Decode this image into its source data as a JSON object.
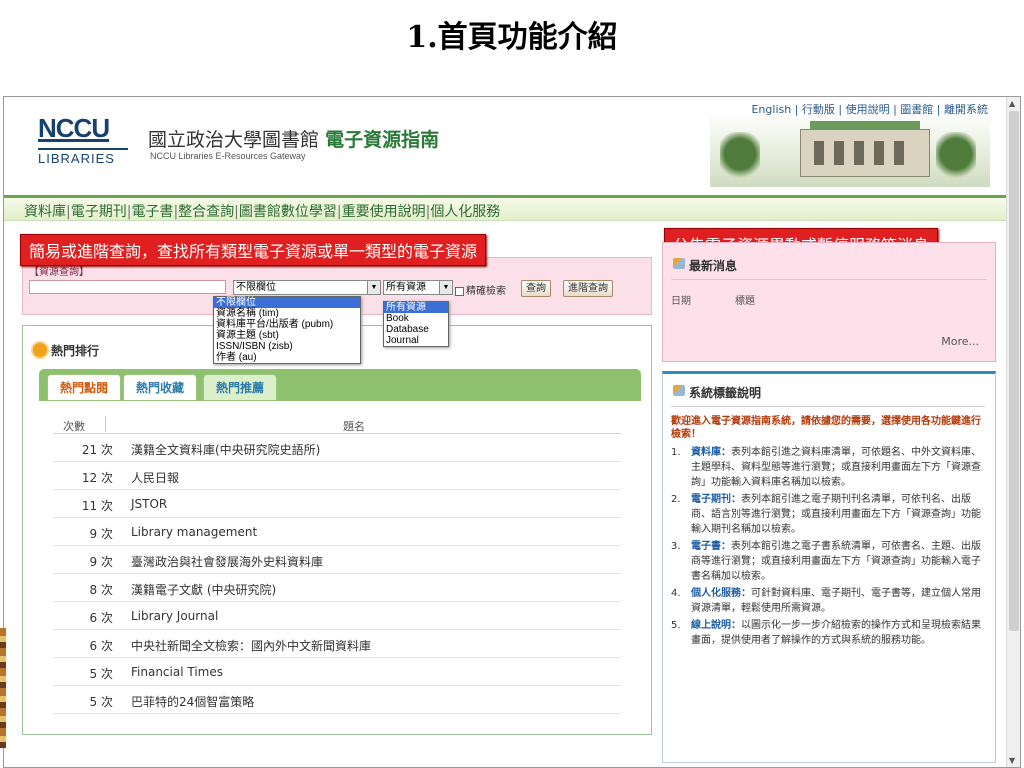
{
  "slide_title": "1.首頁功能介紹",
  "header": {
    "logo_main": "NCCU",
    "logo_sub": "LIBRARIES",
    "site_name_prefix": "國立政治大學圖書館",
    "site_name_suffix": "電子資源指南",
    "site_subtitle": "NCCU Libraries E-Resources Gateway",
    "top_links": "English | 行動版 | 使用說明 | 圖書館 | 離開系統"
  },
  "nav": {
    "items": [
      "資料庫",
      "電子期刊",
      "電子書",
      "整合查詢",
      "圖書館數位學習",
      "重要使用說明",
      "個人化服務"
    ],
    "separator": "|"
  },
  "annotations": {
    "left": "簡易或進階查詢，查找所有類型電子資源或單一類型的電子資源",
    "right": "公告電子資源異動或暫停服務等消息"
  },
  "search": {
    "label": "【資源查詢】",
    "field_select": "不限欄位",
    "type_select": "所有資源",
    "exact_label": "精確檢索",
    "search_button": "查詢",
    "advanced_button": "進階查詢",
    "field_options": [
      "不限欄位",
      "資源名稱 (tim)",
      "資料庫平台/出版者 (pubm)",
      "資源主題 (sbt)",
      "ISSN/ISBN (zisb)",
      "作者 (au)"
    ],
    "type_options": [
      "所有資源",
      "Book",
      "Database",
      "Journal"
    ]
  },
  "hot": {
    "title": "熱門排行",
    "tabs": [
      "熱門點閱",
      "熱門收藏",
      "熱門推薦"
    ],
    "col_count": "次數",
    "col_title": "題名",
    "rows": [
      {
        "count": "21 次",
        "title": "漢籍全文資料庫(中央研究院史語所)"
      },
      {
        "count": "12 次",
        "title": "人民日報"
      },
      {
        "count": "11 次",
        "title": "JSTOR"
      },
      {
        "count": "9 次",
        "title": "Library management"
      },
      {
        "count": "9 次",
        "title": "臺灣政治與社會發展海外史料資料庫"
      },
      {
        "count": "8 次",
        "title": "漢籍電子文獻 (中央研究院)"
      },
      {
        "count": "6 次",
        "title": "Library Journal"
      },
      {
        "count": "6 次",
        "title": "中央社新聞全文檢索：國內外中文新聞資料庫"
      },
      {
        "count": "5 次",
        "title": "Financial Times"
      },
      {
        "count": "5 次",
        "title": "巴菲特的24個智富策略"
      }
    ]
  },
  "news": {
    "title": "最新消息",
    "col_date": "日期",
    "col_title": "標題",
    "more": "More..."
  },
  "system": {
    "title": "系統標籤說明",
    "intro": "歡迎進入電子資源指南系統，請依據您的需要，選擇使用各功能鍵進行檢索！",
    "items": [
      {
        "num": "1.",
        "head": "資料庫：",
        "text": "表列本館引進之資料庫清單，可依題名、中外文資料庫、主題學科、資料型態等進行瀏覽；或直接利用畫面左下方「資源查詢」功能輸入資料庫名稱加以檢索。"
      },
      {
        "num": "2.",
        "head": "電子期刊：",
        "text": "表列本館引進之電子期刊刊名清單，可依刊名、出版商、語言別等進行瀏覽；或直接利用畫面左下方「資源查詢」功能輸入期刊名稱加以檢索。"
      },
      {
        "num": "3.",
        "head": "電子書：",
        "text": "表列本館引進之電子書系統清單，可依書名、主題、出版商等進行瀏覽；或直接利用畫面左下方「資源查詢」功能輸入電子書名稱加以檢索。"
      },
      {
        "num": "4.",
        "head": "個人化服務：",
        "text": "可針對資料庫、電子期刊、電子書等，建立個人常用資源清單，輕鬆使用所需資源。"
      },
      {
        "num": "5.",
        "head": "線上說明：",
        "text": "以圖示化一步一步介紹檢索的操作方式和呈現檢索結果畫面，提供使用者了解操作的方式與系統的服務功能。"
      }
    ]
  }
}
